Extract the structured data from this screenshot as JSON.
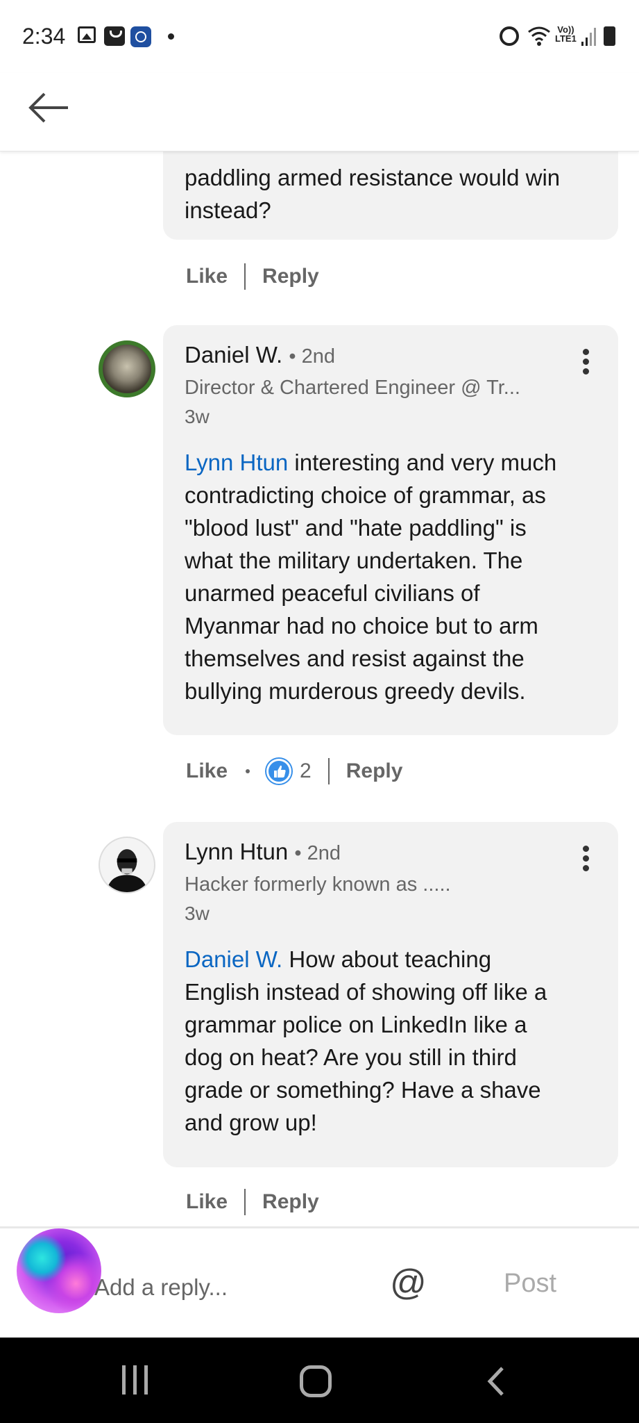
{
  "status_bar": {
    "time": "2:34",
    "volte_line1": "Vo))",
    "volte_line2": "LTE1"
  },
  "header": {
    "back_icon": "arrow-left-icon"
  },
  "thread": {
    "prev_comment": {
      "text_line1": "paddling armed resistance would win",
      "text_line2": "instead?",
      "like_label": "Like",
      "reply_label": "Reply"
    },
    "comments": [
      {
        "author": "Daniel W.",
        "degree": "• 2nd",
        "headline": "Director & Chartered Engineer @ Tr...",
        "time": "3w",
        "mention": "Lynn Htun",
        "lines": [
          " interesting and very much",
          "contradicting choice of grammar, as",
          "\"blood lust\" and \"hate paddling\" is",
          "what the military undertaken. The",
          "unarmed peaceful civilians of",
          "Myanmar had no choice but to arm",
          "themselves and resist against the",
          "bullying murderous greedy devils."
        ],
        "like_label": "Like",
        "reaction_count": "2",
        "reply_label": "Reply"
      },
      {
        "author": "Lynn Htun",
        "degree": "• 2nd",
        "headline": "Hacker formerly known as .....",
        "time": "3w",
        "mention": "Daniel W.",
        "lines": [
          " How about teaching",
          "English instead of showing off like a",
          "grammar police on LinkedIn like a",
          "dog on heat?  Are you still in third",
          "grade or something? Have a shave",
          "and grow up!"
        ],
        "like_label": "Like",
        "reply_label": "Reply"
      }
    ]
  },
  "reply_bar": {
    "placeholder": "Add a reply...",
    "mention_symbol": "@",
    "post_label": "Post"
  },
  "colors": {
    "link_blue": "#0a66c2",
    "bubble_bg": "#f2f2f2",
    "muted_text": "#666666",
    "reaction_blue": "#378fe9"
  }
}
